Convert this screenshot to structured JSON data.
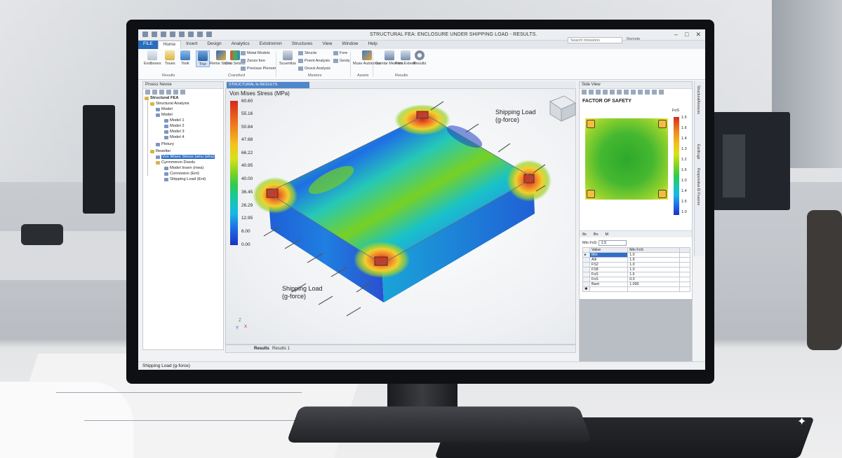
{
  "window": {
    "title": "STRUCTURAL FEA: ENCLOSURE UNDER SHIPPING LOAD - RESULTS.",
    "search_placeholder": "Search Imissions",
    "remote": "Remote"
  },
  "menu": [
    "FILE",
    "Home",
    "Insert",
    "Design",
    "Analytics",
    "Extstinmnn",
    "Structures",
    "View",
    "Window",
    "Help"
  ],
  "ribbon": {
    "buttons": [
      "Endboxes",
      "Toues",
      "Took",
      "Trur",
      "Reme Stomu",
      "Con Setsus",
      "Scuentiss",
      "Muse Autoinnes",
      "Camlar Meshins",
      "Fnm Exteetr",
      "Results"
    ],
    "small": [
      "Metal Models",
      "Zeoss fore",
      "Precisse Plenom",
      "Structe",
      "Poent Analysis",
      "Onsck Anslysis",
      "Fore",
      "Geoty"
    ],
    "groups": [
      "Results",
      "Cransfurd",
      "Mestors",
      "Assets",
      "Results"
    ]
  },
  "left_pane": {
    "title": "Proess Nevoe",
    "tree": [
      "Structural FEA",
      "Structural Analysis",
      "Model",
      "Model",
      "Model 1",
      "Model 2",
      "Model 3",
      "Model 4",
      "Plotury",
      "Reseltsr",
      "Von Mises Stress (wnu (stra)",
      "Cyrmmmon Dseds",
      "Model Insen (mea)",
      "Connosion (Ent)",
      "Shipping Load (Ent)"
    ]
  },
  "center": {
    "tab": "STRUCTURAL fe RESULTS",
    "legend_title": "Von Mises Stress (MPa)",
    "legend_values": [
      "60.60",
      "55.16",
      "50.84",
      "47.68",
      "66.22",
      "40.95",
      "40.00",
      "36.45",
      "26.29",
      "12.95",
      "6.00",
      "0.00"
    ],
    "load_label_top": "Shipping Load",
    "load_unit_top": "(g-force)",
    "load_label_bottom": "Shipping Load",
    "load_unit_bottom": "(g-force)",
    "bottom_tabs": [
      "Results",
      "Results 1"
    ],
    "axes": [
      "Z",
      "X",
      "Y"
    ]
  },
  "right_pane": {
    "title": "Side View",
    "plot_title": "FACTOR OF SAFETY",
    "legend_title": "FoS",
    "legend_values": [
      "1.5",
      "1.6",
      "1.4",
      "1.3",
      "1.2",
      "1.6",
      "1.0",
      "1.4",
      "1.5",
      "1.0"
    ],
    "tabs": [
      "8s",
      "Bn",
      "M"
    ],
    "min_label": "Min FoS",
    "min_value": "1.5",
    "grid_headers": [
      "Value",
      "Min FoS"
    ],
    "grid_rows": [
      [
        "Min",
        "1.0"
      ],
      [
        "Alli",
        "1.6"
      ],
      [
        "FS2",
        "1.0"
      ],
      [
        "FS8",
        "1.0"
      ],
      [
        "FoS",
        "1.6"
      ],
      [
        "FoS",
        "0.0"
      ],
      [
        "Bant",
        "1.000"
      ],
      [
        "",
        ""
      ]
    ],
    "side_tabs": [
      "StructuralAnnaces",
      "Eacttruge",
      "Responstive El Fouores"
    ]
  },
  "status": "Shipping Load (g-force)"
}
